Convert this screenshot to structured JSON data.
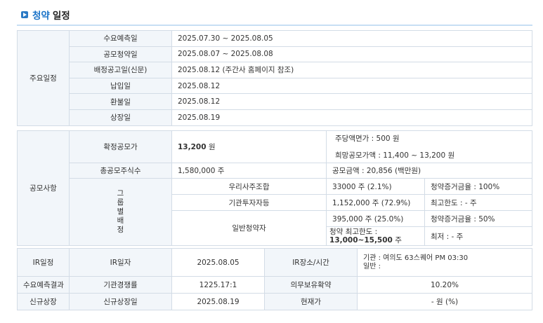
{
  "section_title": {
    "part1": "청약",
    "part2": "일정"
  },
  "schedule": {
    "group_label": "주요일정",
    "rows": [
      {
        "label": "수요예측일",
        "value": "2025.07.30  ~  2025.08.05"
      },
      {
        "label": "공모청약일",
        "value": "2025.08.07  ~  2025.08.08"
      },
      {
        "label": "배정공고일(신문)",
        "value": "2025.08.12 (주간사 홈페이지 참조)"
      },
      {
        "label": "납입일",
        "value": "2025.08.12"
      },
      {
        "label": "환불일",
        "value": "2025.08.12"
      },
      {
        "label": "상장일",
        "value": "2025.08.19"
      }
    ]
  },
  "offering": {
    "group_label": "공모사항",
    "final_price_label": "확정공모가",
    "final_price_value": "13,200",
    "final_price_unit": "원",
    "par_value": "주당액면가 :  500 원",
    "hope_price": "희망공모가액 :  11,400 ~ 13,200 원",
    "total_shares_label": "총공모주식수",
    "total_shares_value": "1,580,000 주",
    "total_amount": "공모금액 : 20,856 (백만원)",
    "group_alloc_label": "그룹별배정",
    "employee_label": "우리사주조합",
    "employee_shares": "33000 주  (2.1%)",
    "employee_deposit": "청약증거금율 : 100%",
    "institution_label": "기관투자자등",
    "institution_shares": "1,152,000 주  (72.9%)",
    "institution_limit": "최고한도 :  - 주",
    "retail_label": "일반청약자",
    "retail_shares": "395,000 주  (25.0%)",
    "retail_deposit": "청약증거금율 : 50%",
    "retail_max_label": "청약 최고한도 :",
    "retail_max_value": "13,000~15,500",
    "retail_max_unit": "주",
    "retail_min": "최저 :  - 주"
  },
  "ir": {
    "group_label": "IR일정",
    "date_label": "IR일자",
    "date_value": "2025.08.05",
    "place_label": "IR장소/시간",
    "place_line1": "기관 : 여의도 63스퀘어 PM 03:30",
    "place_line2": "일반 :"
  },
  "demand": {
    "group_label": "수요예측결과",
    "competition_label": "기관경쟁률",
    "competition_value": "1225.17:1",
    "lockup_label": "의무보유확약",
    "lockup_value": "10.20%"
  },
  "listing": {
    "group_label": "신규상장",
    "date_label": "신규상장일",
    "date_value": "2025.08.19",
    "current_label": "현재가",
    "current_value": "- 원 (%)"
  }
}
